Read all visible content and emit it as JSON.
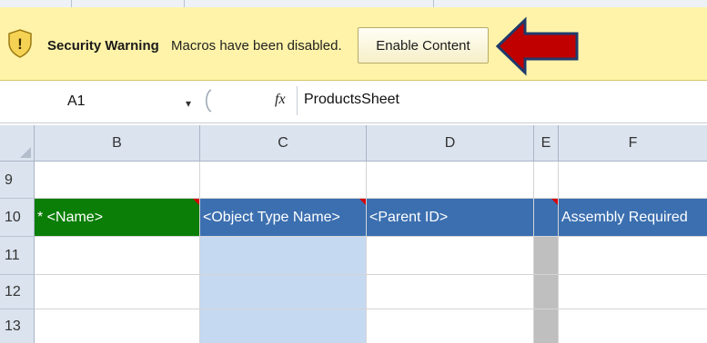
{
  "message_bar": {
    "title": "Security Warning",
    "text": "Macros have been disabled.",
    "button_label": "Enable Content",
    "warning_icon_glyph": "!",
    "icons": [
      "shield-warning-icon",
      "arrow-left-icon"
    ],
    "colors": {
      "bar": "#fef3a8",
      "arrow": "#c00000",
      "arrow_outline": "#1f3a6b"
    }
  },
  "formula_bar": {
    "name_box": "A1",
    "name_dropdown_glyph": "▾",
    "fx_label": "fx",
    "content": "ProductsSheet"
  },
  "sheet": {
    "columns": [
      "B",
      "C",
      "D",
      "E",
      "F"
    ],
    "rows": [
      "9",
      "10",
      "11",
      "12",
      "13"
    ],
    "header_row_cells": [
      "* <Name>",
      "<Object Type Name>",
      "<Parent ID>",
      "",
      "Assembly Required"
    ],
    "colors": {
      "green_header": "#0a7e07",
      "blue_header": "#3b6fb0",
      "light_blue_fill": "#c5d9f1",
      "grey_fill": "#bfbfbf",
      "comment_marker": "#d40000"
    }
  }
}
